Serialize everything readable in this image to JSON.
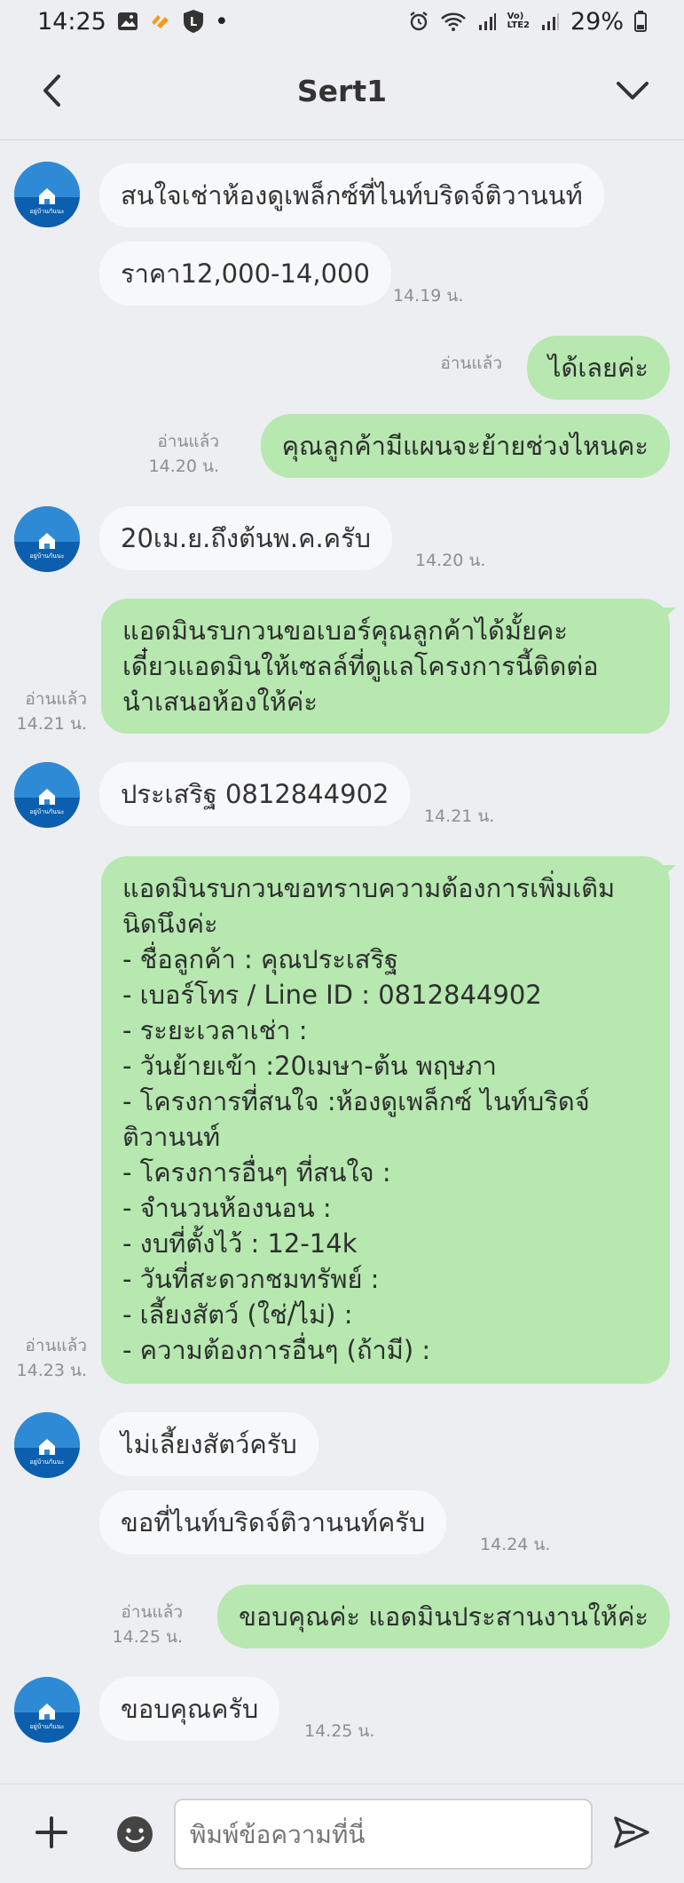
{
  "status_bar": {
    "time": "14:25",
    "battery": "29%",
    "dot": "•",
    "l_badge": "L",
    "volte_label": "Vo)\nLTE2"
  },
  "header": {
    "title": "Sert1"
  },
  "avatar_caption": "อยู่บ้านกันนะ",
  "messages": [
    {
      "side": "in",
      "text": "สนใจเช่าห้องดูเพล็กซ์ที่ไนท์บริดจ์ติวานนท์"
    },
    {
      "side": "in",
      "text": "ราคา12,000-14,000",
      "time": "14.19 น."
    },
    {
      "side": "out",
      "text": "ได้เลยค่ะ",
      "read": "อ่านแล้ว"
    },
    {
      "side": "out",
      "text": "คุณลูกค้ามีแผนจะย้ายช่วงไหนคะ",
      "read": "อ่านแล้ว",
      "time": "14.20 น."
    },
    {
      "side": "in",
      "text": "20เม.ย.ถึงต้นพ.ค.ครับ",
      "time": "14.20 น."
    },
    {
      "side": "out",
      "lines": [
        "แอดมินรบกวนขอเบอร์คุณลูกค้าได้มั้ยคะ",
        "เดี๋ยวแอดมินให้เซลล์ที่ดูแลโครงการนี้ติดต่อ",
        "นำเสนอห้องให้ค่ะ"
      ],
      "read": "อ่านแล้ว",
      "time": "14.21 น."
    },
    {
      "side": "in",
      "text": "ประเสริฐ 0812844902",
      "time": "14.21 น."
    },
    {
      "side": "out",
      "lines": [
        "แอดมินรบกวนขอทราบความต้องการเพิ่มเติม",
        "นิดนึงค่ะ",
        "- ชื่อลูกค้า : คุณประเสริฐ",
        "- เบอร์โทร / Line ID : 0812844902",
        "- ระยะเวลาเช่า :",
        "- วันย้ายเข้า :20เมษา-ต้น พฤษภา",
        "- โครงการที่สนใจ :ห้องดูเพล็กซ์ ไนท์บริดจ์",
        "ติวานนท์",
        "- โครงการอื่นๆ ที่สนใจ :",
        "- จำนวนห้องนอน :",
        "- งบที่ตั้งไว้ : 12-14k",
        "- วันที่สะดวกชมทรัพย์ :",
        "- เลี้ยงสัตว์ (ใช่/ไม่) :",
        "- ความต้องการอื่นๆ (ถ้ามี) :"
      ],
      "read": "อ่านแล้ว",
      "time": "14.23 น."
    },
    {
      "side": "in",
      "text": "ไม่เลี้ยงสัตว์ครับ"
    },
    {
      "side": "in",
      "text": "ขอที่ไนท์บริดจ์ติวานนท์ครับ",
      "time": "14.24 น."
    },
    {
      "side": "out",
      "text": "ขอบคุณค่ะ แอดมินประสานงานให้ค่ะ",
      "read": "อ่านแล้ว",
      "time": "14.25 น."
    },
    {
      "side": "in",
      "text": "ขอบคุณครับ",
      "time": "14.25 น."
    }
  ],
  "input": {
    "placeholder": "พิมพ์ข้อความที่นี่"
  },
  "colors": {
    "background": "#edeef2",
    "incoming_bubble": "#f7f8fa",
    "outgoing_bubble": "#b6e8b0",
    "meta_text": "#8c8e94"
  }
}
